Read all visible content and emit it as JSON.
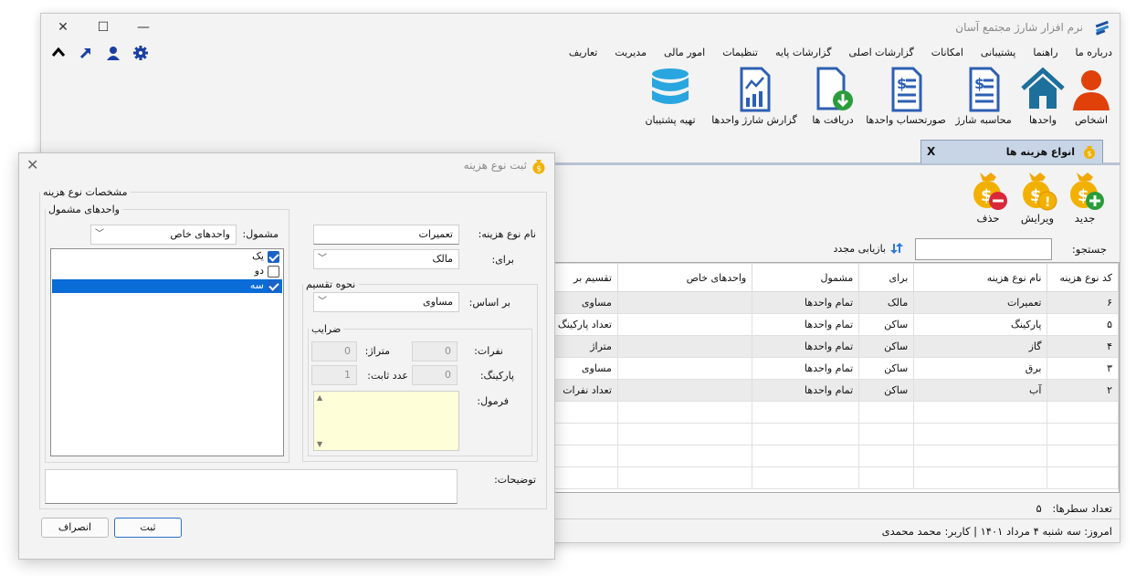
{
  "app": {
    "title": "نرم افزار شارژ مجتمع آسان"
  },
  "window_controls": {
    "close": "✕",
    "maximize": "☐",
    "minimize": "—"
  },
  "menu": [
    "تعاریف",
    "مدیریت",
    "امور مالی",
    "تنظیمات",
    "گزارشات پایه",
    "گزارشات اصلی",
    "امکانات",
    "پشتیبانی",
    "راهنما",
    "درباره ما"
  ],
  "ribbon": {
    "persons": "اشخاص",
    "units": "واحدها",
    "charge_calc": "محاسبه شارژ",
    "unit_bills": "صورتحساب واحدها",
    "receipts": "دریافت ها",
    "unit_charge_report": "گزارش شارژ واحدها",
    "backup": "تهیه پشتیبان"
  },
  "tab": {
    "label": "انواع هزینه ها",
    "close": "X"
  },
  "toolbar": {
    "new": "جدید",
    "edit": "ویرایش",
    "delete": "حذف"
  },
  "search": {
    "label": "جستجو:",
    "value": "",
    "refresh": "بازیابی مجدد"
  },
  "grid": {
    "columns": [
      "کد نوع هزینه",
      "نام نوع هزینه",
      "برای",
      "مشمول",
      "واحدهای خاص",
      "تقسیم بر"
    ],
    "rows": [
      [
        "۶",
        "تعمیرات",
        "مالک",
        "تمام واحدها",
        "",
        "مساوی"
      ],
      [
        "۵",
        "پارکینگ",
        "ساکن",
        "تمام واحدها",
        "",
        "تعداد پارکینگ"
      ],
      [
        "۴",
        "گاز",
        "ساکن",
        "تمام واحدها",
        "",
        "متراژ"
      ],
      [
        "۳",
        "برق",
        "ساکن",
        "تمام واحدها",
        "",
        "مساوی"
      ],
      [
        "۲",
        "آب",
        "ساکن",
        "تمام واحدها",
        "",
        "تعداد نفرات"
      ]
    ]
  },
  "row_count": {
    "label": "تعداد سطرها:",
    "value": "۵"
  },
  "status": {
    "text": "امروز: سه شنبه ۴ مرداد ۱۴۰۱ | کاربر: محمد محمدی"
  },
  "dialog": {
    "title": "ثبت نوع هزینه",
    "group_main": "مشخصات نوع هزینه",
    "name_label": "نام نوع هزینه:",
    "name_value": "تعمیرات",
    "for_label": "برای:",
    "for_value": "مالک",
    "group_division": "نحوه تقسیم",
    "basis_label": "بر اساس:",
    "basis_value": "مساوی",
    "group_coeff": "ضرایب",
    "persons_label": "نفرات:",
    "persons_value": "0",
    "area_label": "متراژ:",
    "area_value": "0",
    "parking_label": "پارکینگ:",
    "parking_value": "0",
    "fixed_label": "عدد ثابت:",
    "fixed_value": "1",
    "formula_label": "فرمول:",
    "group_units": "واحدهای مشمول",
    "included_label": "مشمول:",
    "included_value": "واحدهای خاص",
    "units": [
      {
        "label": "یک",
        "checked": true,
        "selected": false
      },
      {
        "label": "دو",
        "checked": false,
        "selected": false
      },
      {
        "label": "سه",
        "checked": true,
        "selected": true
      }
    ],
    "notes_label": "توضیحات:",
    "save": "ثبت",
    "cancel": "انصراف"
  }
}
